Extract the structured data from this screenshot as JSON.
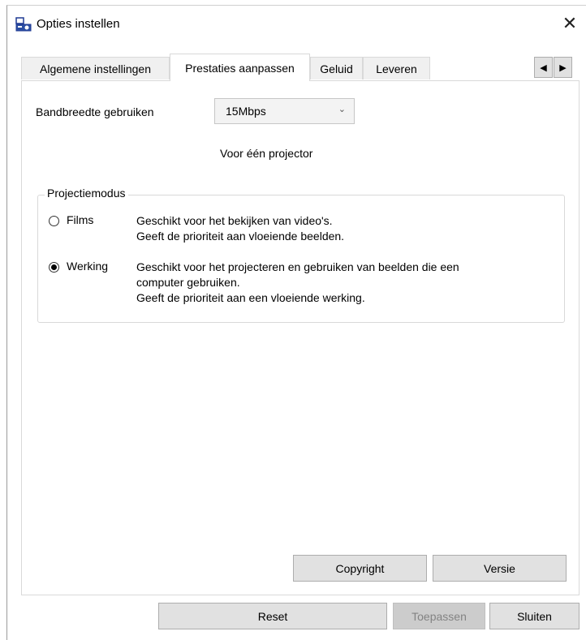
{
  "window": {
    "title": "Opties instellen",
    "close_glyph": "✕",
    "icon": "projector-app-icon"
  },
  "tabs": [
    {
      "label": "Algemene instellingen",
      "active": false
    },
    {
      "label": "Prestaties aanpassen",
      "active": true
    },
    {
      "label": "Geluid",
      "active": false
    },
    {
      "label": "Leveren",
      "active": false
    }
  ],
  "tab_scroll": {
    "left_glyph": "◀",
    "right_glyph": "▶"
  },
  "bandwidth": {
    "label": "Bandbreedte gebruiken",
    "value": "15Mbps",
    "note": "Voor één projector"
  },
  "projection_mode": {
    "legend": "Projectiemodus",
    "options": [
      {
        "label": "Films",
        "checked": false,
        "description": [
          "Geschikt voor het bekijken van video's.",
          "Geeft de prioriteit aan vloeiende beelden."
        ]
      },
      {
        "label": "Werking",
        "checked": true,
        "description": [
          "Geschikt voor het projecteren en gebruiken van beelden die een",
          "computer gebruiken.",
          "Geeft de prioriteit aan een vloeiende werking."
        ]
      }
    ]
  },
  "panel_buttons": {
    "copyright": "Copyright",
    "version": "Versie"
  },
  "footer_buttons": {
    "reset": "Reset",
    "apply": "Toepassen",
    "close": "Sluiten"
  },
  "colors": {
    "button_bg": "#e1e1e1",
    "disabled_text": "#838383"
  }
}
